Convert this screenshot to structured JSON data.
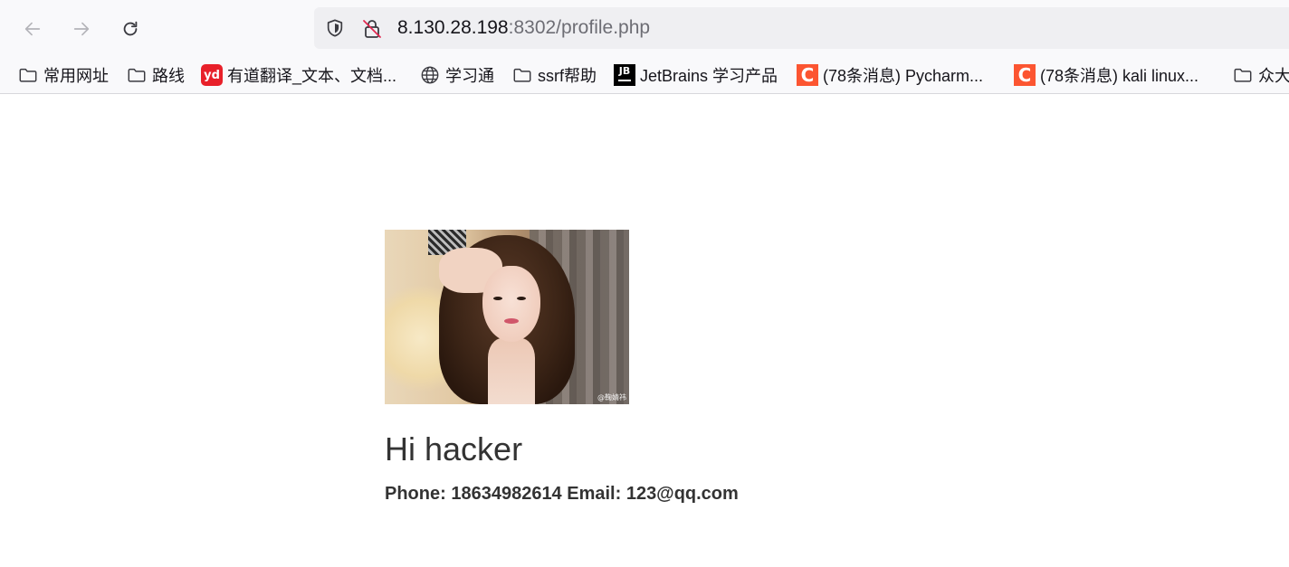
{
  "browser": {
    "url_host": "8.130.28.198",
    "url_rest": ":8302/profile.php",
    "icons": {
      "back": "arrow-left-icon",
      "forward": "arrow-right-icon",
      "reload": "reload-icon",
      "tracking": "shield-icon",
      "insecure": "insecure-lock-icon"
    }
  },
  "bookmarks": [
    {
      "label": "常用网址",
      "icon": "folder-icon"
    },
    {
      "label": "路线",
      "icon": "folder-icon"
    },
    {
      "label": "有道翻译_文本、文档...",
      "icon": "youdao-icon",
      "icon_text": "yd"
    },
    {
      "label": "学习通",
      "icon": "globe-icon"
    },
    {
      "label": "ssrf帮助",
      "icon": "folder-icon"
    },
    {
      "label": "JetBrains 学习产品",
      "icon": "jetbrains-icon",
      "icon_text": "JB"
    },
    {
      "label": "(78条消息) Pycharm...",
      "icon": "csdn-icon",
      "icon_text": "C"
    },
    {
      "label": "(78条消息) kali linux...",
      "icon": "csdn-icon",
      "icon_text": "C"
    },
    {
      "label": "众大",
      "icon": "folder-icon"
    }
  ],
  "profile": {
    "photo_watermark": "@鞠婧祎",
    "greeting": "Hi hacker",
    "contact": "Phone: 18634982614 Email: 123@qq.com"
  },
  "colors": {
    "toolbar_bg": "#f9f9fb",
    "urlbar_bg": "#efeff2",
    "text": "#333333",
    "csdn": "#fc5531",
    "youdao": "#e8202a"
  }
}
